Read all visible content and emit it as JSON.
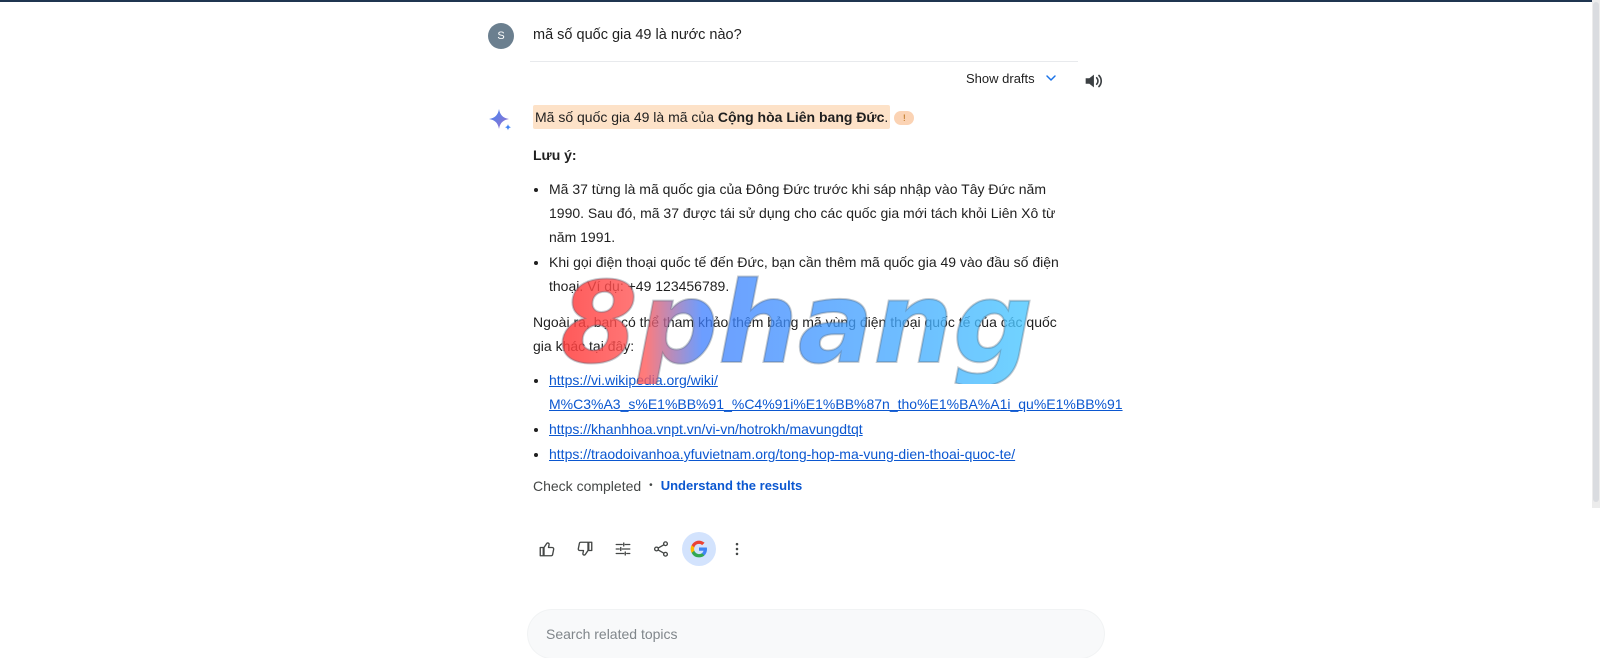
{
  "user": {
    "avatar_initial": "S",
    "prompt": "mã số quốc gia 49 là nước nào?"
  },
  "toolbar": {
    "show_drafts": "Show drafts",
    "chevron_icon": "chevron-down-icon",
    "speaker_icon": "volume-icon"
  },
  "response": {
    "icon": "gemini-sparkle-icon",
    "headline_prefix": "Mã số quốc gia 49 là mã của ",
    "headline_bold": "Cộng hòa Liên bang Đức",
    "headline_suffix": ".",
    "badge": "!",
    "note_title": "Lưu ý:",
    "bullets": [
      "Mã 37 từng là mã quốc gia của Đông Đức trước khi sáp nhập vào Tây Đức năm 1990. Sau đó, mã 37 được tái sử dụng cho các quốc gia mới tách khỏi Liên Xô từ năm 1991.",
      "Khi gọi điện thoại quốc tế đến Đức, bạn cần thêm mã quốc gia 49 vào đầu số điện thoại. Ví dụ: +49 123456789."
    ],
    "paragraph": "Ngoài ra, bạn có thể tham khảo thêm bảng mã vùng điện thoại quốc tế của các quốc gia khác tại đây:",
    "links": [
      {
        "line1": "https://vi.wikipedia.org/wiki/",
        "line2": "M%C3%A3_s%E1%BB%91_%C4%91i%E1%BB%87n_tho%E1%BA%A1i_qu%E1%BB%91"
      },
      {
        "line1": "https://khanhhoa.vnpt.vn/vi-vn/hotrokh/mavungdtqt"
      },
      {
        "line1": "https://traodoivanhoa.yfuvietnam.org/tong-hop-ma-vung-dien-thoai-quoc-te/"
      }
    ],
    "check_completed": "Check completed",
    "separator": "•",
    "understand_results": "Understand the results"
  },
  "actions": [
    "thumb-up-icon",
    "thumb-down-icon",
    "tune-icon",
    "share-icon",
    "google-g-icon",
    "more-vert-icon"
  ],
  "search": {
    "placeholder": "Search related topics"
  },
  "watermark": {
    "text": "8phang"
  },
  "colors": {
    "link": "#0b57d0",
    "highlight": "#fde2c8",
    "accent": "#1a73e8"
  }
}
